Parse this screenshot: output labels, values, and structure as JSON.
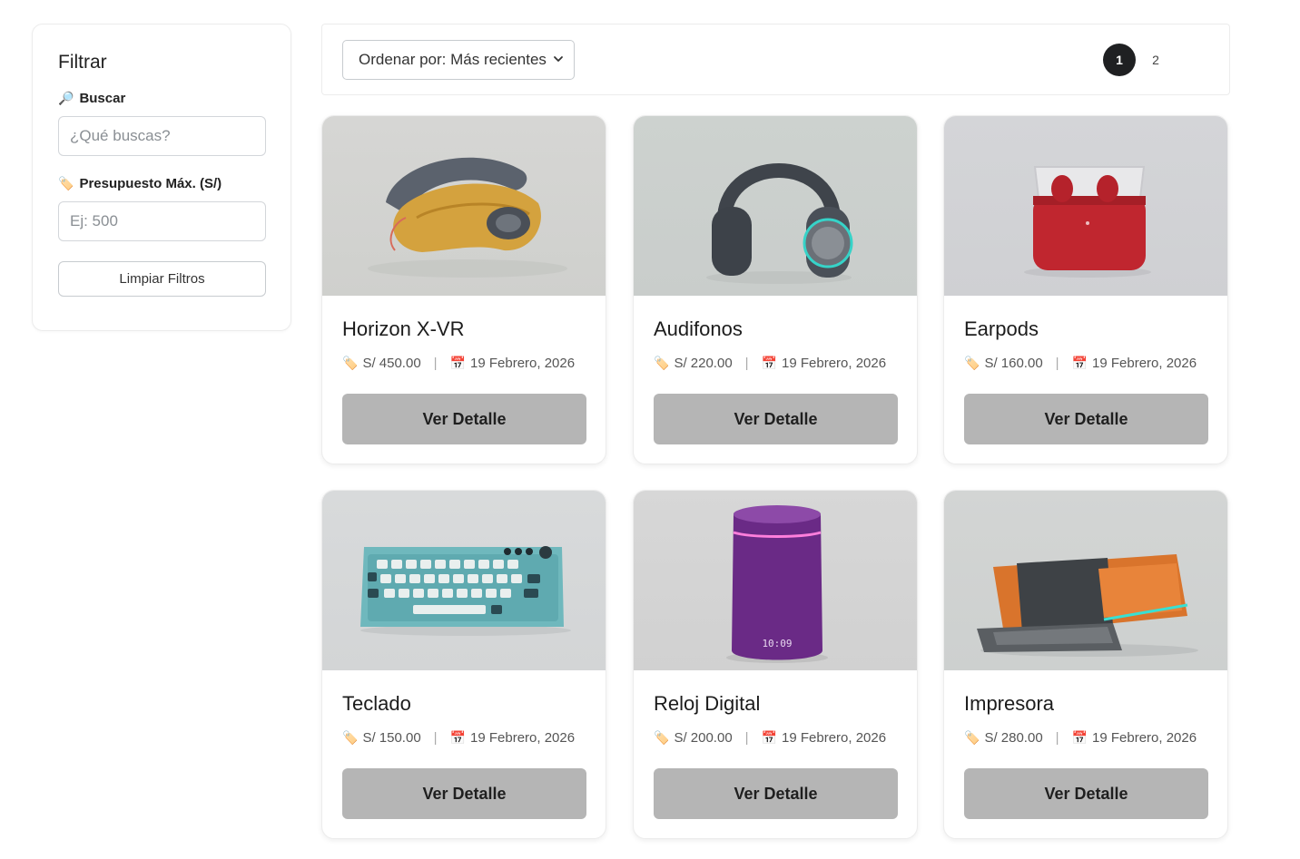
{
  "sidebar": {
    "title": "Filtrar",
    "search_label": "Buscar",
    "search_icon": "🔎",
    "search_placeholder": "¿Qué buscas?",
    "budget_label": "Presupuesto Máx. (S/)",
    "budget_icon": "🏷️",
    "budget_placeholder": "Ej: 500",
    "clear_label": "Limpiar Filtros"
  },
  "toolbar": {
    "sort_label": "Ordenar por: Más recientes",
    "pages": [
      "1",
      "2"
    ],
    "active_page": "1"
  },
  "icons": {
    "price": "🏷️",
    "date": "📅",
    "separator": "|"
  },
  "products": [
    {
      "name": "Horizon X-VR",
      "price": "S/ 450.00",
      "date": "19 Febrero, 2026",
      "button": "Ver Detalle",
      "image": "vr-headset"
    },
    {
      "name": "Audifonos",
      "price": "S/ 220.00",
      "date": "19 Febrero, 2026",
      "button": "Ver Detalle",
      "image": "headphones"
    },
    {
      "name": "Earpods",
      "price": "S/ 160.00",
      "date": "19 Febrero, 2026",
      "button": "Ver Detalle",
      "image": "earbuds-case"
    },
    {
      "name": "Teclado",
      "price": "S/ 150.00",
      "date": "19 Febrero, 2026",
      "button": "Ver Detalle",
      "image": "keyboard"
    },
    {
      "name": "Reloj Digital",
      "price": "S/ 200.00",
      "date": "19 Febrero, 2026",
      "button": "Ver Detalle",
      "image": "smart-speaker-clock",
      "image_text": "10:09"
    },
    {
      "name": "Impresora",
      "price": "S/ 280.00",
      "date": "19 Febrero, 2026",
      "button": "Ver Detalle",
      "image": "printer"
    }
  ],
  "colors": {
    "button_bg": "#b5b5b5",
    "active_page_bg": "#1f2022"
  }
}
